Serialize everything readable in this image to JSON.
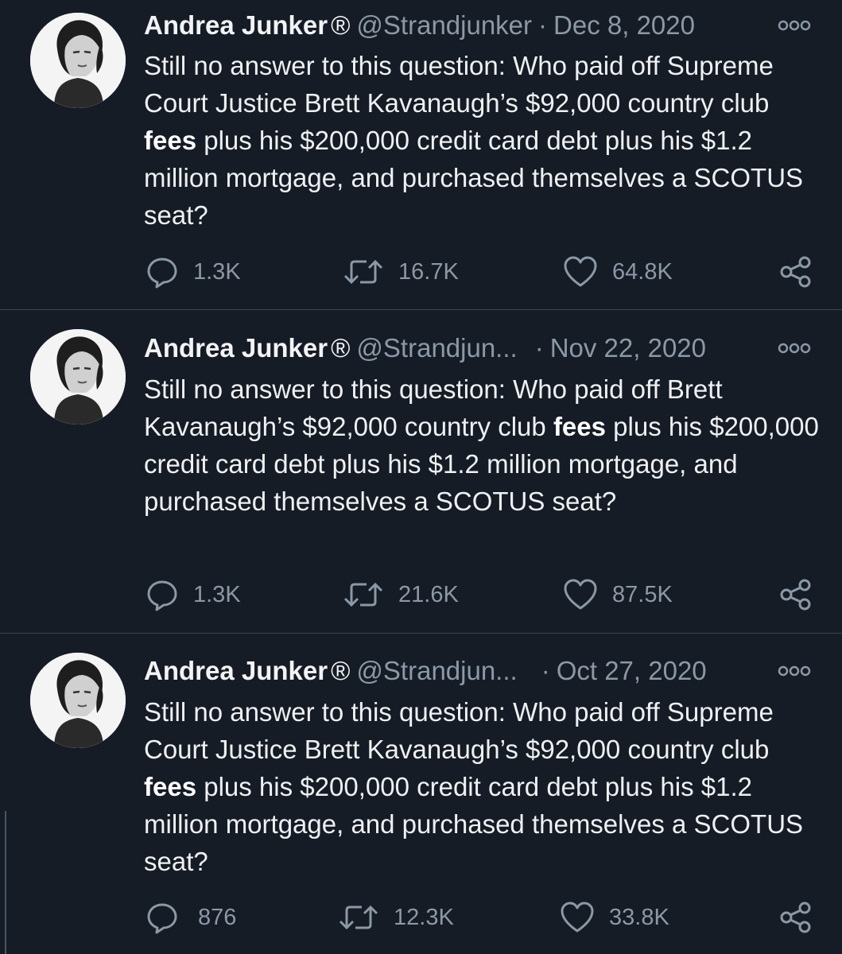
{
  "tweets": [
    {
      "author_name": "Andrea Junker",
      "registered_mark": "®",
      "handle": "@Strandjunker",
      "separator": "·",
      "date": "Dec 8, 2020",
      "text_before": "Still no answer to this question: Who paid off Supreme Court Justice Brett Kavanaugh’s $92,000 country club ",
      "text_bold": "fees",
      "text_after": " plus his $200,000 credit card debt plus his $1.2 million mortgage, and purchased themselves a SCOTUS seat?",
      "replies": "1.3K",
      "retweets": "16.7K",
      "likes": "64.8K"
    },
    {
      "author_name": "Andrea Junker",
      "registered_mark": "®",
      "handle": "@Strandjun...",
      "separator": "·",
      "date": "Nov 22, 2020",
      "text_before": "Still no answer to this question: Who paid off Brett Kavanaugh’s $92,000 country club ",
      "text_bold": "fees",
      "text_after": " plus his $200,000 credit card debt plus his $1.2 million mortgage, and purchased themselves a SCOTUS seat?",
      "replies": "1.3K",
      "retweets": "21.6K",
      "likes": "87.5K"
    },
    {
      "author_name": "Andrea Junker",
      "registered_mark": "®",
      "handle": "@Strandjun...",
      "separator": "·",
      "date": "Oct 27, 2020",
      "text_before": "Still no answer to this question: Who paid off Supreme Court Justice Brett Kavanaugh’s $92,000 country club ",
      "text_bold": "fees",
      "text_after": " plus his $200,000 credit card debt plus his $1.2 million mortgage, and purchased themselves a SCOTUS seat?",
      "replies": "876",
      "retweets": "12.3K",
      "likes": "33.8K"
    }
  ],
  "icons": {
    "reply": "reply-icon",
    "retweet": "retweet-icon",
    "like": "heart-icon",
    "share": "share-icon",
    "more": "more-options-icon"
  },
  "colors": {
    "background": "#151c26",
    "text": "#eef0f1",
    "secondary_text": "#8b98a5",
    "divider": "#3a4450"
  }
}
